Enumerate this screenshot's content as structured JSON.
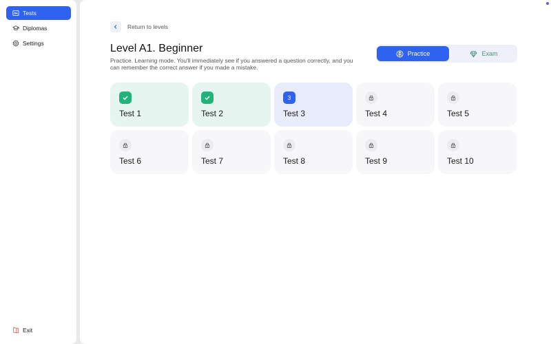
{
  "sidebar": {
    "items": [
      {
        "label": "Tests",
        "icon": "tests-icon",
        "active": true
      },
      {
        "label": "Diplomas",
        "icon": "graduation-cap-icon",
        "active": false
      },
      {
        "label": "Settings",
        "icon": "gear-icon",
        "active": false
      }
    ],
    "exit_label": "Exit"
  },
  "header": {
    "back_label": "Return to levels",
    "title": "Level A1. Beginner",
    "description": "Practice. Learning mode. You'll immediately see if you answered a question correctly, and you can remember the correct answer if you made a mistake."
  },
  "mode": {
    "practice_label": "Practice",
    "exam_label": "Exam",
    "selected": "Practice"
  },
  "colors": {
    "accent": "#2f62f0",
    "success": "#22b37c",
    "exit_icon": "#e0473b"
  },
  "tests": [
    {
      "name": "Test 1",
      "status": "done",
      "badge": ""
    },
    {
      "name": "Test 2",
      "status": "done",
      "badge": ""
    },
    {
      "name": "Test 3",
      "status": "current",
      "badge": "3"
    },
    {
      "name": "Test 4",
      "status": "locked",
      "badge": ""
    },
    {
      "name": "Test 5",
      "status": "locked",
      "badge": ""
    },
    {
      "name": "Test 6",
      "status": "locked",
      "badge": ""
    },
    {
      "name": "Test 7",
      "status": "locked",
      "badge": ""
    },
    {
      "name": "Test 8",
      "status": "locked",
      "badge": ""
    },
    {
      "name": "Test 9",
      "status": "locked",
      "badge": ""
    },
    {
      "name": "Test 10",
      "status": "locked",
      "badge": ""
    }
  ]
}
